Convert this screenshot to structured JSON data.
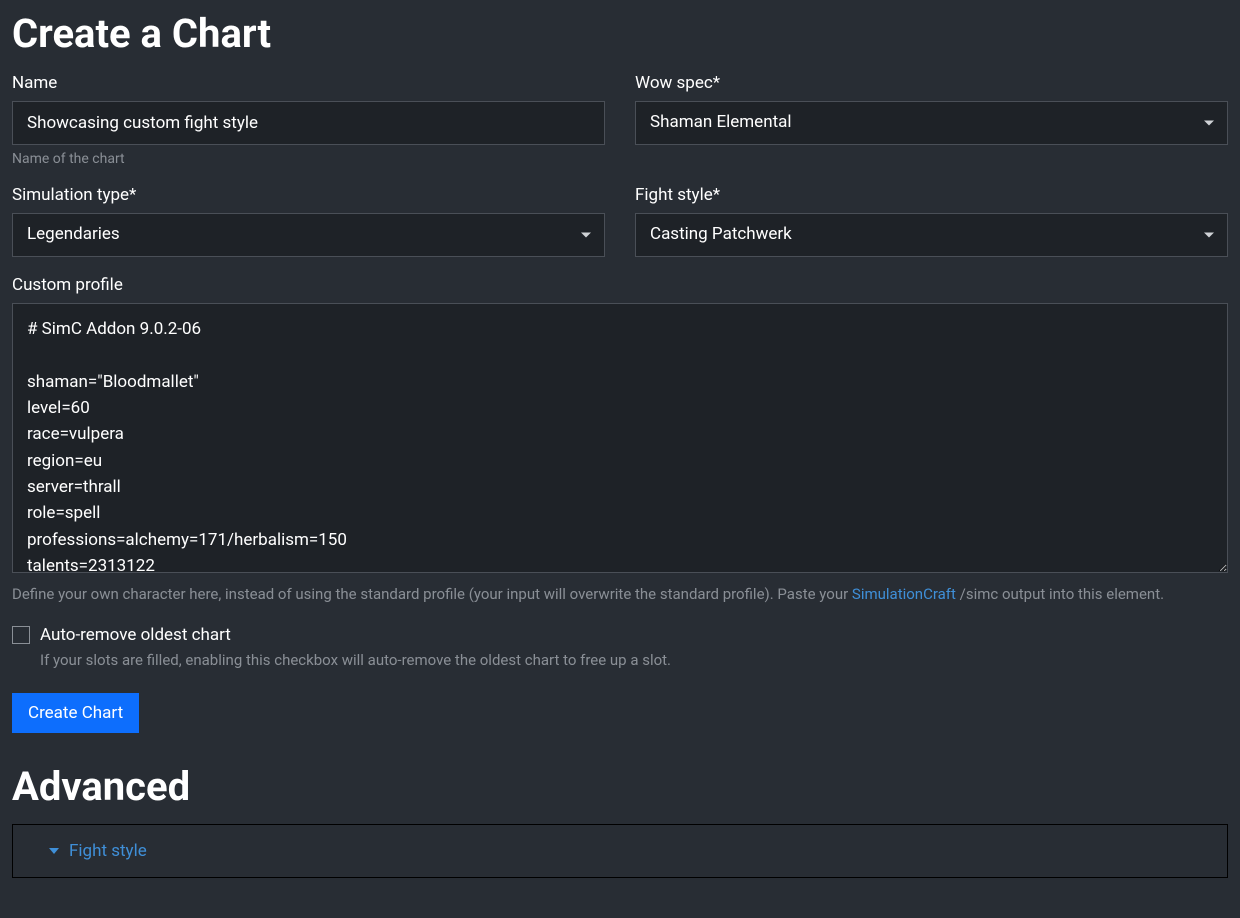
{
  "page_title": "Create a Chart",
  "name": {
    "label": "Name",
    "value": "Showcasing custom fight style",
    "helper": "Name of the chart"
  },
  "wow_spec": {
    "label": "Wow spec*",
    "value": "Shaman Elemental"
  },
  "simulation_type": {
    "label": "Simulation type*",
    "value": "Legendaries"
  },
  "fight_style": {
    "label": "Fight style*",
    "value": "Casting Patchwerk"
  },
  "custom_profile": {
    "label": "Custom profile",
    "value": "# SimC Addon 9.0.2-06\n\nshaman=\"Bloodmallet\"\nlevel=60\nrace=vulpera\nregion=eu\nserver=thrall\nrole=spell\nprofessions=alchemy=171/herbalism=150\ntalents=2313122",
    "helper_before": "Define your own character here, instead of using the standard profile (your input will overwrite the standard profile). Paste your ",
    "helper_link": "SimulationCraft",
    "helper_after": " /simc output into this element."
  },
  "auto_remove": {
    "label": "Auto-remove oldest chart",
    "checked": false,
    "helper": "If your slots are filled, enabling this checkbox will auto-remove the oldest chart to free up a slot."
  },
  "submit_label": "Create Chart",
  "advanced": {
    "title": "Advanced",
    "items": [
      {
        "label": "Fight style"
      }
    ]
  }
}
